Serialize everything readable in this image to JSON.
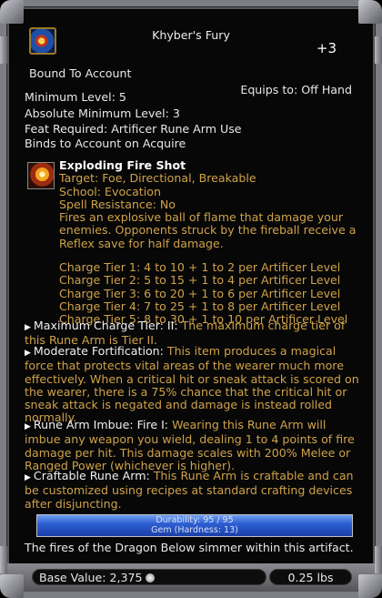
{
  "item": {
    "name": "Khyber's Fury",
    "enhancement": "+3",
    "bound": "Bound To Account",
    "equips": "Equips to: Off Hand",
    "min_level": "Minimum Level: 5",
    "abs_min_level": "Absolute Minimum Level: 3",
    "feat_required": "Feat Required: Artificer Rune Arm Use",
    "binds": "Binds to Account on Acquire"
  },
  "spell": {
    "title": "Exploding Fire Shot",
    "target": "Target: Foe, Directional, Breakable",
    "school": "School: Evocation",
    "resistance": "Spell Resistance: No",
    "description": "Fires an explosive ball of flame that damage your enemies. Opponents struck by the fireball receive a Reflex save for half damage.",
    "tiers": [
      "Charge Tier 1: 4 to 10 + 1 to 2 per Artificer Level",
      "Charge Tier 2: 5 to 15 + 1 to 4 per Artificer Level",
      "Charge Tier 3: 6 to 20 + 1 to 6 per Artificer Level",
      "Charge Tier 4: 7 to 25 + 1 to 8 per Artificer Level",
      "Charge Tier 5: 8 to 30 + 1 to 10 per Artificer Level"
    ]
  },
  "effects": [
    {
      "name": "Maximum Charge Tier: II:",
      "text": " The maximum charge tier of this Rune Arm is Tier II."
    },
    {
      "name": "Moderate Fortification:",
      "text": " This item produces a magical force that protects vital areas of the wearer much more effectively. When a critical hit or sneak attack is scored on the wearer, there is a 75% chance that the critical hit or sneak attack is negated and damage is instead rolled normally."
    },
    {
      "name": "Rune Arm Imbue: Fire I:",
      "text": " Wearing this Rune Arm will imbue any weapon you wield, dealing 1 to 4 points of fire damage per hit. This damage scales with 200% Melee or Ranged Power (whichever is higher)."
    },
    {
      "name": "Craftable Rune Arm:",
      "text": " This Rune Arm is craftable and can be customized using recipes at standard crafting devices after disjuncting."
    }
  ],
  "durability": "Durability: 95 / 95",
  "gem": "Gem (Hardness: 13)",
  "flavor": "The fires of the Dragon Below simmer within this artifact.",
  "base_value": "Base Value: 2,375",
  "weight": "0.25 lbs",
  "colors": {
    "gold_text": "#cfa24a",
    "bar_blue": "#2d5fd3",
    "frame": "#7d7d84"
  },
  "icons": [
    "item-icon",
    "exploding-fire-shot-icon",
    "bullet-arrow-icon",
    "coin-icon"
  ]
}
